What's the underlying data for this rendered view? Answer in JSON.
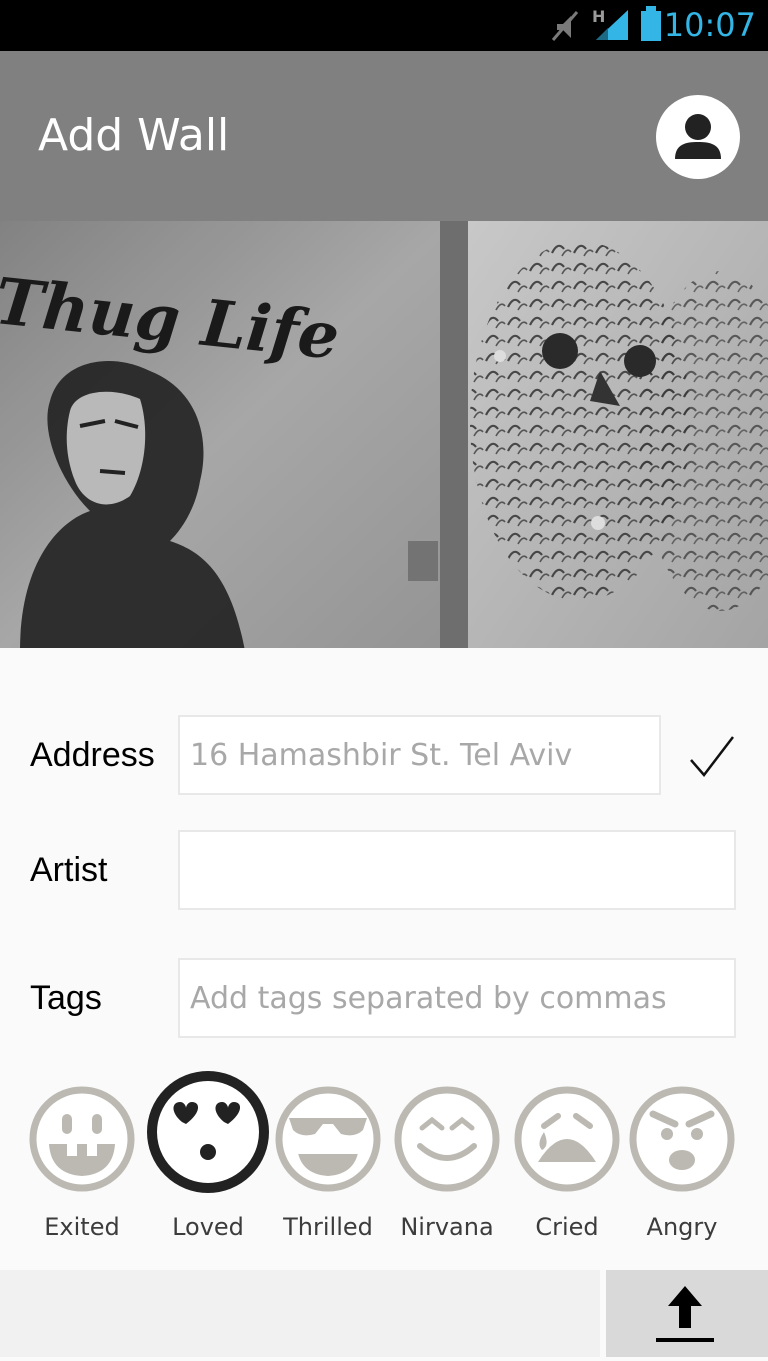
{
  "status_bar": {
    "time": "10:07",
    "icons": [
      "mute-icon",
      "signal-h-icon",
      "battery-icon"
    ],
    "time_color": "#33b5e5"
  },
  "app_bar": {
    "title": "Add Wall",
    "profile_icon": "person-icon",
    "background": "#808080"
  },
  "photo": {
    "text": "Thug Life"
  },
  "form": {
    "address": {
      "label": "Address",
      "value": "16 Hamashbir St. Tel Aviv",
      "confirm_icon": "checkmark-icon"
    },
    "artist": {
      "label": "Artist",
      "value": ""
    },
    "tags": {
      "label": "Tags",
      "placeholder": "Add tags separated by commas"
    }
  },
  "moods": [
    {
      "label": "Exited",
      "icon": "grin-face-icon",
      "selected": false
    },
    {
      "label": "Loved",
      "icon": "heart-eyes-face-icon",
      "selected": true
    },
    {
      "label": "Thrilled",
      "icon": "sunglasses-face-icon",
      "selected": false
    },
    {
      "label": "Nirvana",
      "icon": "smiling-eyes-face-icon",
      "selected": false
    },
    {
      "label": "Cried",
      "icon": "crying-face-icon",
      "selected": false
    },
    {
      "label": "Angry",
      "icon": "angry-face-icon",
      "selected": false
    }
  ],
  "bottom_bar": {
    "upload_icon": "upload-arrow-icon"
  }
}
